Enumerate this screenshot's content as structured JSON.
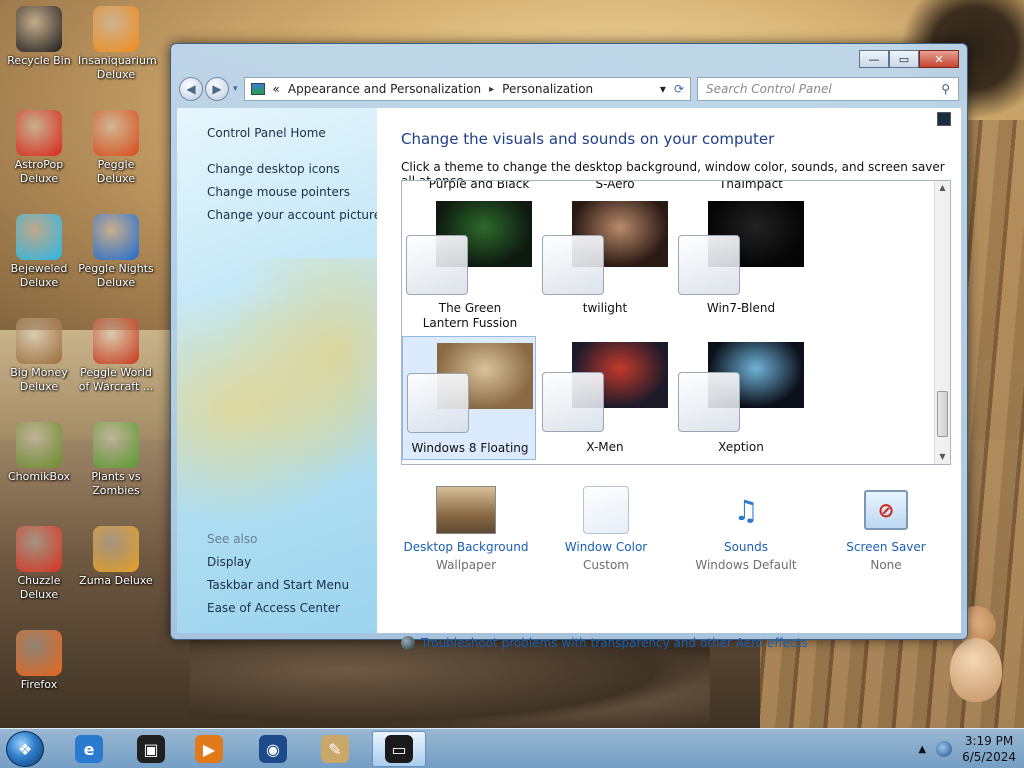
{
  "desktop": {
    "icons": [
      {
        "label": "Recycle Bin",
        "icon": "recycle-bin-icon",
        "color": "#1c1c1c"
      },
      {
        "label": "Insaniquarium Deluxe",
        "icon": "goldfish-icon",
        "color": "#f08a1a"
      },
      {
        "label": "AstroPop Deluxe",
        "icon": "astropop-icon",
        "color": "#d9261c"
      },
      {
        "label": "Peggle Deluxe",
        "icon": "peggle-icon",
        "color": "#d84a1a"
      },
      {
        "label": "Bejeweled Deluxe",
        "icon": "diamond-icon",
        "color": "#27b8e6"
      },
      {
        "label": "Peggle Nights Deluxe",
        "icon": "peggle-nights-icon",
        "color": "#1f6bd1"
      },
      {
        "label": "Big Money Deluxe",
        "icon": "money-bag-icon",
        "color": "#9c6b3a"
      },
      {
        "label": "Peggle World of Warcraft ...",
        "icon": "peggle-wow-icon",
        "color": "#c9381a"
      },
      {
        "label": "ChomikBox",
        "icon": "chomikbox-icon",
        "color": "#6b8e2a"
      },
      {
        "label": "Plants vs Zombies",
        "icon": "plants-vs-zombies-icon",
        "color": "#5b9b2e"
      },
      {
        "label": "Chuzzle Deluxe",
        "icon": "chuzzle-icon",
        "color": "#d9331f"
      },
      {
        "label": "Zuma Deluxe",
        "icon": "zuma-icon",
        "color": "#e6a022"
      },
      {
        "label": "Firefox",
        "icon": "firefox-icon",
        "color": "#e8661a"
      }
    ]
  },
  "window": {
    "controls": {
      "minimize": "—",
      "maximize": "▭",
      "close": "✕"
    },
    "address": {
      "chevron": "«",
      "crumbs": [
        "Appearance and Personalization",
        "Personalization"
      ],
      "separator": "▸",
      "dropdown": "▾",
      "refresh": "⟳"
    },
    "search_placeholder": "Search Control Panel",
    "left_nav": {
      "home": "Control Panel Home",
      "links": [
        "Change desktop icons",
        "Change mouse pointers",
        "Change your account picture"
      ],
      "see_also_label": "See also",
      "see_also": [
        "Display",
        "Taskbar and Start Menu",
        "Ease of Access Center"
      ]
    },
    "main": {
      "title": "Change the visuals and sounds on your computer",
      "subtitle": "Click a theme to change the desktop background, window color, sounds, and screen saver all at once.",
      "top_row_labels": [
        "Purple and Black",
        "S-Aero",
        "ThaImpact"
      ],
      "themes": [
        {
          "name": "The Green Lantern Fussion",
          "bg": "#0e1a10",
          "accent": "#2d6a2b",
          "selected": false
        },
        {
          "name": "twilight",
          "bg": "#2a1a14",
          "accent": "#b98a6a",
          "selected": false
        },
        {
          "name": "Win7-Blend",
          "bg": "#050505",
          "accent": "#222222",
          "selected": false
        },
        {
          "name": "Windows 8 Floating",
          "bg": "#8a6a44",
          "accent": "#d9c39a",
          "selected": true
        },
        {
          "name": "X-Men",
          "bg": "#1d1a2a",
          "accent": "#c33a2a",
          "selected": false
        },
        {
          "name": "Xeption",
          "bg": "#0a0f18",
          "accent": "#6fb3d8",
          "selected": false
        }
      ],
      "bottom": [
        {
          "link": "Desktop Background",
          "sub": "Wallpaper",
          "icon": "wallpaper-thumbnail-icon"
        },
        {
          "link": "Window Color",
          "sub": "Custom",
          "icon": "window-color-icon"
        },
        {
          "link": "Sounds",
          "sub": "Windows Default",
          "icon": "sounds-icon"
        },
        {
          "link": "Screen Saver",
          "sub": "None",
          "icon": "screen-saver-icon"
        }
      ],
      "troubleshoot": "Troubleshoot problems with transparency and other Aero effects"
    }
  },
  "taskbar": {
    "apps": [
      {
        "name": "internet-explorer-icon",
        "glyph": "e",
        "color": "#2a7ad0",
        "active": false
      },
      {
        "name": "control-panel-icon",
        "glyph": "▣",
        "color": "#202020",
        "active": false
      },
      {
        "name": "media-player-icon",
        "glyph": "▶",
        "color": "#e07a1a",
        "active": false
      },
      {
        "name": "globe-icon",
        "glyph": "◉",
        "color": "#1c4a8a",
        "active": false
      },
      {
        "name": "paint-icon",
        "glyph": "✎",
        "color": "#c9a86a",
        "active": false
      },
      {
        "name": "personalization-window-icon",
        "glyph": "▭",
        "color": "#1a1a1a",
        "active": true
      }
    ],
    "tray": {
      "arrow": "▲",
      "time": "3:19 PM",
      "date": "6/5/2024"
    }
  }
}
